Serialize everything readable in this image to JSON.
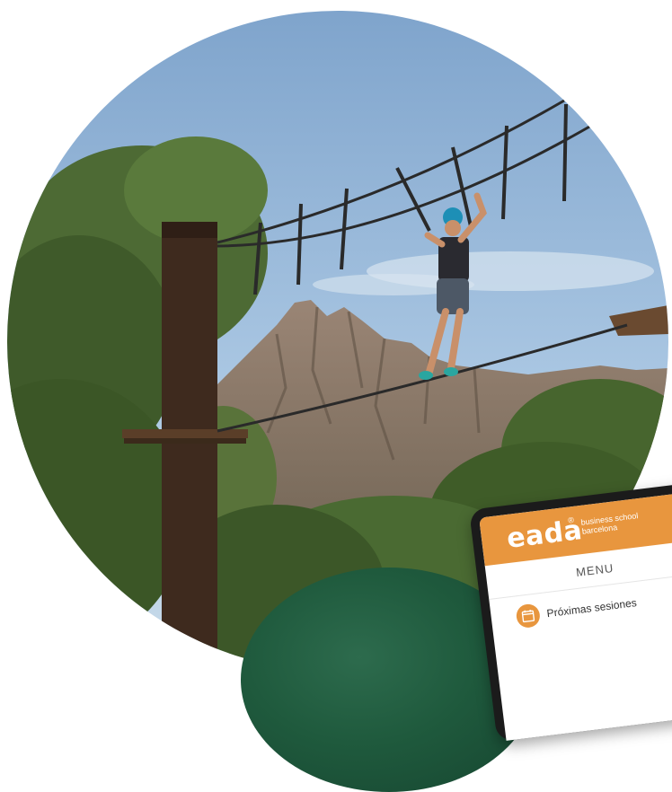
{
  "colors": {
    "sky": "#8db1d6",
    "accent": "#e8963e",
    "foliage": "#3e5a2a",
    "rock": "#8a7a6c"
  },
  "app": {
    "brand": "eada",
    "registered_mark": "®",
    "brand_sub_line1": "business school",
    "brand_sub_line2": "barcelona",
    "menu_title": "MENU",
    "menu_items": [
      {
        "icon": "calendar-icon",
        "label": "Próximas sesiones"
      }
    ]
  }
}
